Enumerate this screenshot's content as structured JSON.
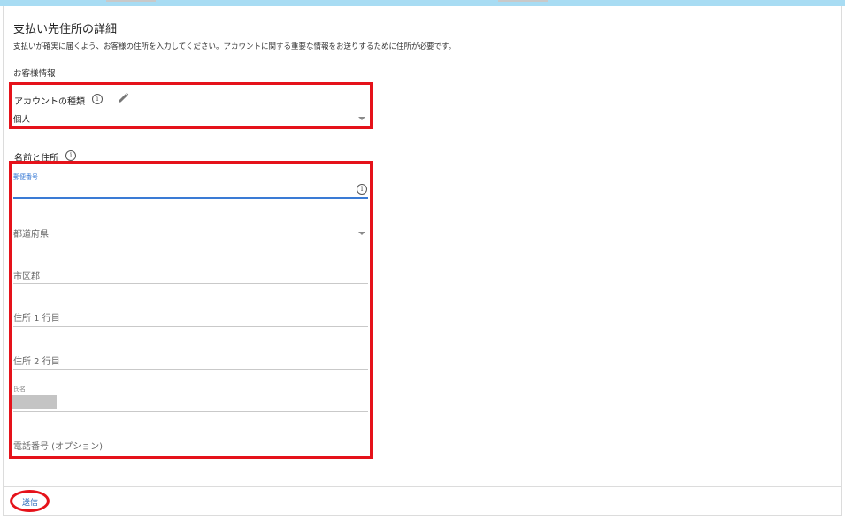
{
  "header": {
    "title": "支払い先住所の詳細",
    "description": "支払いが確実に届くよう、お客様の住所を入力してください。アカウントに関する重要な情報をお送りするために住所が必要です。"
  },
  "customer_info": {
    "section_label": "お客様情報",
    "account_type_label": "アカウントの種類",
    "account_type_value": "個人"
  },
  "name_address": {
    "section_label": "名前と住所",
    "postal_code_label": "郵便番号",
    "postal_code_value": "",
    "prefecture_placeholder": "都道府県",
    "city_placeholder": "市区郡",
    "address1_placeholder": "住所 1 行目",
    "address2_placeholder": "住所 2 行目",
    "name_label": "氏名",
    "phone_placeholder": "電話番号 (オプション)"
  },
  "footer": {
    "submit_label": "送信"
  },
  "colors": {
    "accent": "#3a7bd5",
    "highlight": "#e5121a",
    "top_bar": "#a8dcf3",
    "link": "#1a5fb4"
  },
  "icons": [
    "info-icon",
    "pencil-icon",
    "dropdown-caret-icon"
  ]
}
